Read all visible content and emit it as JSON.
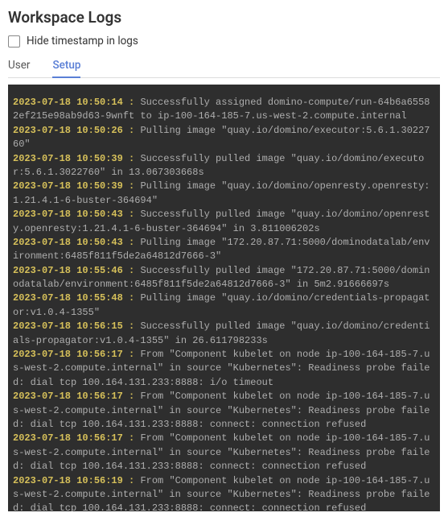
{
  "header": {
    "title": "Workspace Logs",
    "hide_ts_label": "Hide timestamp in logs",
    "hide_ts_checked": false
  },
  "tabs": [
    {
      "label": "User",
      "active": false
    },
    {
      "label": "Setup",
      "active": true
    }
  ],
  "logs": [
    {
      "ts": "2023-07-18 10:50:14 : ",
      "msg": "Successfully assigned domino-compute/run-64b6a65582ef215e98ab9d63-9wnft to ip-100-164-185-7.us-west-2.compute.internal"
    },
    {
      "ts": "2023-07-18 10:50:26 : ",
      "msg": "Pulling image \"quay.io/domino/executor:5.6.1.3022760\""
    },
    {
      "ts": "2023-07-18 10:50:39 : ",
      "msg": "Successfully pulled image \"quay.io/domino/executor:5.6.1.3022760\" in 13.067303668s"
    },
    {
      "ts": "2023-07-18 10:50:39 : ",
      "msg": "Pulling image \"quay.io/domino/openresty.openresty:1.21.4.1-6-buster-364694\""
    },
    {
      "ts": "2023-07-18 10:50:43 : ",
      "msg": "Successfully pulled image \"quay.io/domino/openresty.openresty:1.21.4.1-6-buster-364694\" in 3.811006202s"
    },
    {
      "ts": "2023-07-18 10:50:43 : ",
      "msg": "Pulling image \"172.20.87.71:5000/dominodatalab/environment:6485f811f5de2a64812d7666-3\""
    },
    {
      "ts": "2023-07-18 10:55:46 : ",
      "msg": "Successfully pulled image \"172.20.87.71:5000/dominodatalab/environment:6485f811f5de2a64812d7666-3\" in 5m2.91666697s"
    },
    {
      "ts": "2023-07-18 10:55:48 : ",
      "msg": "Pulling image \"quay.io/domino/credentials-propagator:v1.0.4-1355\""
    },
    {
      "ts": "2023-07-18 10:56:15 : ",
      "msg": "Successfully pulled image \"quay.io/domino/credentials-propagator:v1.0.4-1355\" in 26.611798233s"
    },
    {
      "ts": "2023-07-18 10:56:17 : ",
      "msg": "From \"Component kubelet on node ip-100-164-185-7.us-west-2.compute.internal\" in source \"Kubernetes\": Readiness probe failed: dial tcp 100.164.131.233:8888: i/o timeout"
    },
    {
      "ts": "2023-07-18 10:56:17 : ",
      "msg": "From \"Component kubelet on node ip-100-164-185-7.us-west-2.compute.internal\" in source \"Kubernetes\": Readiness probe failed: dial tcp 100.164.131.233:8888: connect: connection refused"
    },
    {
      "ts": "2023-07-18 10:56:17 : ",
      "msg": "From \"Component kubelet on node ip-100-164-185-7.us-west-2.compute.internal\" in source \"Kubernetes\": Readiness probe failed: dial tcp 100.164.131.233:8888: connect: connection refused"
    },
    {
      "ts": "2023-07-18 10:56:19 : ",
      "msg": "From \"Component kubelet on node ip-100-164-185-7.us-west-2.compute.internal\" in source \"Kubernetes\": Readiness probe failed: dial tcp 100.164.131.233:8888: connect: connection refused"
    }
  ]
}
